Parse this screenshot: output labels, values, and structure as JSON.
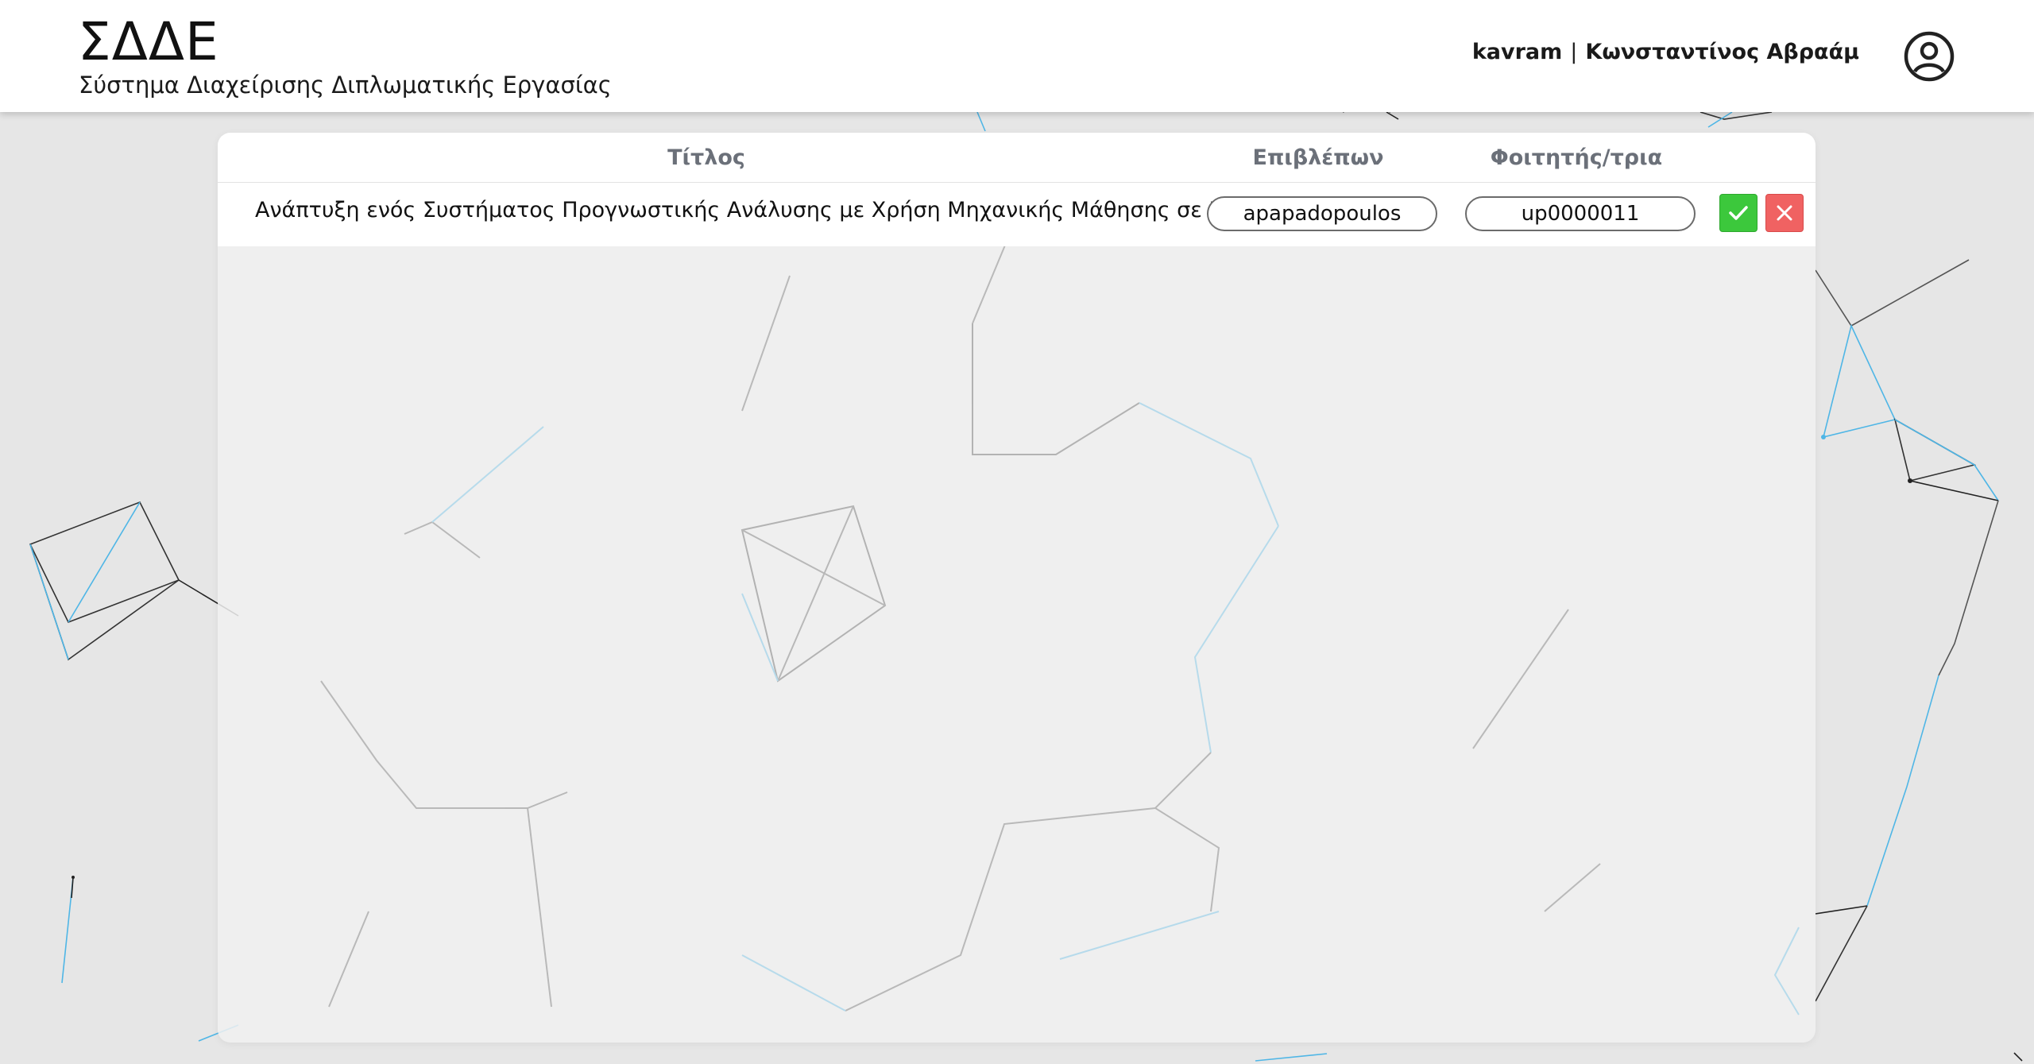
{
  "header": {
    "brand_title": "ΣΔΔΕ",
    "brand_subtitle": "Σύστημα Διαχείρισης Διπλωματικής Εργασίας",
    "username": "kavram",
    "separator": "|",
    "full_name": "Κωνσταντίνος Αβραάμ",
    "account_icon": "account-circle-icon"
  },
  "table": {
    "columns": {
      "title": "Τίτλος",
      "supervisor": "Επιβλέπων",
      "student": "Φοιτητής/τρια"
    },
    "rows": [
      {
        "title": "Ανάπτυξη ενός Συστήματος Προγνωστικής Ανάλυσης με Χρήση Μηχανικής Μάθησης σε Big Data.",
        "supervisor": "apapadopoulos",
        "student": "up0000011",
        "accept_icon": "check-icon",
        "reject_icon": "close-icon"
      }
    ]
  },
  "colors": {
    "accept": "#3cc83c",
    "reject": "#f06262",
    "network_blue": "#4fb6e6",
    "network_dark": "#2a2a2a"
  }
}
